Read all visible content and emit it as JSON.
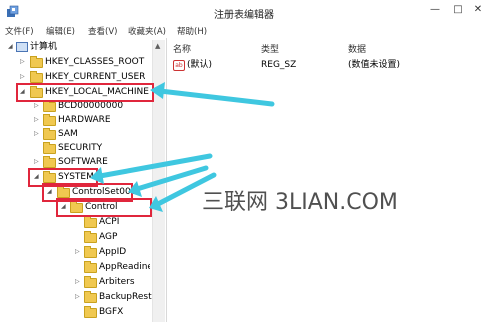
{
  "window": {
    "title": "注册表编辑器",
    "controls": {
      "minimize": "—",
      "maximize": "□",
      "close": "✕"
    }
  },
  "menu": [
    "文件(F)",
    "编辑(E)",
    "查看(V)",
    "收藏夹(A)",
    "帮助(H)"
  ],
  "tree": {
    "root": "计算机",
    "items": [
      {
        "label": "HKEY_CLASSES_ROOT"
      },
      {
        "label": "HKEY_CURRENT_USER"
      },
      {
        "label": "HKEY_LOCAL_MACHINE"
      },
      {
        "label": "BCD00000000"
      },
      {
        "label": "HARDWARE"
      },
      {
        "label": "SAM"
      },
      {
        "label": "SECURITY"
      },
      {
        "label": "SOFTWARE"
      },
      {
        "label": "SYSTEM"
      },
      {
        "label": "ControlSet001"
      },
      {
        "label": "Control"
      },
      {
        "label": "ACPI"
      },
      {
        "label": "AGP"
      },
      {
        "label": "AppID"
      },
      {
        "label": "AppReadine"
      },
      {
        "label": "Arbiters"
      },
      {
        "label": "BackupResto"
      },
      {
        "label": "BGFX"
      }
    ]
  },
  "list": {
    "columns": [
      "名称",
      "类型",
      "数据"
    ],
    "rows": [
      {
        "name": "(默认)",
        "type": "REG_SZ",
        "data": "(数值未设置)"
      }
    ]
  },
  "watermark": "三联网 3LIAN.COM",
  "colors": {
    "highlight_box": "#e0263c",
    "arrow": "#3fc7e0",
    "folder": "#f0c850"
  }
}
